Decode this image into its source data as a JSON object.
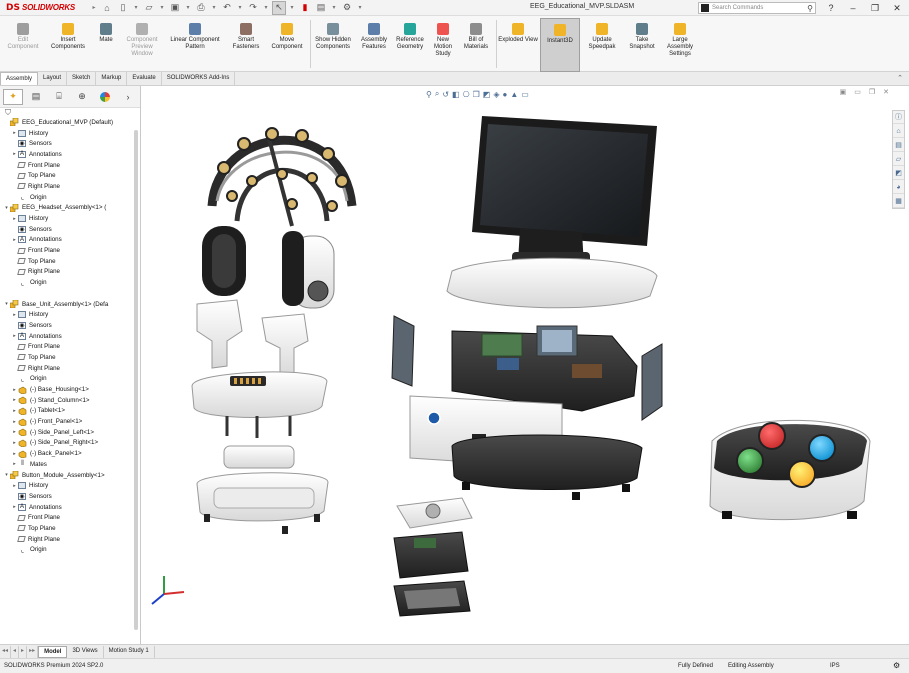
{
  "app": {
    "logo_ds": "DS",
    "logo_name": "SOLIDWORKS",
    "document_title": "EEG_Educational_MVP.SLDASM",
    "search_placeholder": "Search Commands"
  },
  "toolbar": [
    {
      "label": "Edit Component",
      "disabled": true,
      "icon": "edit-component-icon",
      "color": "#9e9e9e"
    },
    {
      "label": "Insert Components",
      "icon": "insert-components-icon",
      "color": "#f0b429"
    },
    {
      "label": "Mate",
      "icon": "mate-icon",
      "color": "#607d8b"
    },
    {
      "label": "Component Preview Window",
      "disabled": true,
      "icon": "preview-window-icon",
      "color": "#b0b0b0"
    },
    {
      "label": "Linear Component Pattern",
      "icon": "pattern-icon",
      "color": "#5c7ea8"
    },
    {
      "label": "Smart Fasteners",
      "icon": "fasteners-icon",
      "color": "#8d6e63"
    },
    {
      "label": "Move Component",
      "icon": "move-component-icon",
      "color": "#f0b429"
    },
    {
      "label": "Show Hidden Components",
      "icon": "show-hidden-icon",
      "color": "#78909c"
    },
    {
      "label": "Assembly Features",
      "icon": "assembly-features-icon",
      "color": "#5c7ea8"
    },
    {
      "label": "Reference Geometry",
      "icon": "reference-geometry-icon",
      "color": "#26a69a"
    },
    {
      "label": "New Motion Study",
      "icon": "motion-study-icon",
      "color": "#ef5350"
    },
    {
      "label": "Bill of Materials",
      "icon": "bom-icon",
      "color": "#8d8d8d"
    },
    {
      "label": "Exploded View",
      "icon": "exploded-view-icon",
      "color": "#f0b429"
    },
    {
      "label": "Instant3D",
      "active": true,
      "icon": "instant3d-icon",
      "color": "#f0b429"
    },
    {
      "label": "Update Speedpak",
      "icon": "speedpak-icon",
      "color": "#f0b429"
    },
    {
      "label": "Take Snapshot",
      "icon": "snapshot-icon",
      "color": "#607d8b"
    },
    {
      "label": "Large Assembly Settings",
      "icon": "large-assembly-icon",
      "color": "#f0b429"
    }
  ],
  "tabs": [
    "Assembly",
    "Layout",
    "Sketch",
    "Markup",
    "Evaluate",
    "SOLIDWORKS Add-Ins"
  ],
  "tree": [
    {
      "level": 0,
      "exp": "",
      "icon": "asm",
      "label": "EEG_Educational_MVP (Default)"
    },
    {
      "level": 1,
      "exp": "▸",
      "icon": "folder",
      "label": "History"
    },
    {
      "level": 1,
      "exp": "",
      "icon": "sensor",
      "label": "Sensors"
    },
    {
      "level": 1,
      "exp": "▸",
      "icon": "annot",
      "label": "Annotations"
    },
    {
      "level": 1,
      "exp": "",
      "icon": "plane",
      "label": "Front Plane"
    },
    {
      "level": 1,
      "exp": "",
      "icon": "plane",
      "label": "Top Plane"
    },
    {
      "level": 1,
      "exp": "",
      "icon": "plane",
      "label": "Right Plane"
    },
    {
      "level": 1,
      "exp": "",
      "icon": "origin",
      "label": "Origin"
    },
    {
      "level": 0,
      "exp": "▾",
      "icon": "asm",
      "label": "EEG_Headset_Assembly<1> ("
    },
    {
      "level": 1,
      "exp": "▸",
      "icon": "folder",
      "label": "History"
    },
    {
      "level": 1,
      "exp": "",
      "icon": "sensor",
      "label": "Sensors"
    },
    {
      "level": 1,
      "exp": "▸",
      "icon": "annot",
      "label": "Annotations"
    },
    {
      "level": 1,
      "exp": "",
      "icon": "plane",
      "label": "Front Plane"
    },
    {
      "level": 1,
      "exp": "",
      "icon": "plane",
      "label": "Top Plane"
    },
    {
      "level": 1,
      "exp": "",
      "icon": "plane",
      "label": "Right Plane"
    },
    {
      "level": 1,
      "exp": "",
      "icon": "origin",
      "label": "Origin"
    },
    {
      "level": -1,
      "exp": "",
      "icon": "",
      "label": ""
    },
    {
      "level": 0,
      "exp": "▾",
      "icon": "asm",
      "label": "Base_Unit_Assembly<1> (Defa"
    },
    {
      "level": 1,
      "exp": "▸",
      "icon": "folder",
      "label": "History"
    },
    {
      "level": 1,
      "exp": "",
      "icon": "sensor",
      "label": "Sensors"
    },
    {
      "level": 1,
      "exp": "▸",
      "icon": "annot",
      "label": "Annotations"
    },
    {
      "level": 1,
      "exp": "",
      "icon": "plane",
      "label": "Front Plane"
    },
    {
      "level": 1,
      "exp": "",
      "icon": "plane",
      "label": "Top Plane"
    },
    {
      "level": 1,
      "exp": "",
      "icon": "plane",
      "label": "Right Plane"
    },
    {
      "level": 1,
      "exp": "",
      "icon": "origin",
      "label": "Origin"
    },
    {
      "level": 1,
      "exp": "▸",
      "icon": "part",
      "label": "(-) Base_Housing<1>"
    },
    {
      "level": 1,
      "exp": "▸",
      "icon": "part",
      "label": "(-) Stand_Column<1>"
    },
    {
      "level": 1,
      "exp": "▸",
      "icon": "part",
      "label": "(-) Tablet<1>"
    },
    {
      "level": 1,
      "exp": "▸",
      "icon": "part",
      "label": "(-) Front_Panel<1>"
    },
    {
      "level": 1,
      "exp": "▸",
      "icon": "part",
      "label": "(-) Side_Panel_Left<1>"
    },
    {
      "level": 1,
      "exp": "▸",
      "icon": "part",
      "label": "(-) Side_Panel_Right<1>"
    },
    {
      "level": 1,
      "exp": "▸",
      "icon": "part",
      "label": "(-) Back_Panel<1>"
    },
    {
      "level": 1,
      "exp": "▸",
      "icon": "mates",
      "label": "Mates"
    },
    {
      "level": 0,
      "exp": "▾",
      "icon": "asm",
      "label": "Button_Module_Assembly<1>"
    },
    {
      "level": 1,
      "exp": "▸",
      "icon": "folder",
      "label": "History"
    },
    {
      "level": 1,
      "exp": "",
      "icon": "sensor",
      "label": "Sensors"
    },
    {
      "level": 1,
      "exp": "▸",
      "icon": "annot",
      "label": "Annotations"
    },
    {
      "level": 1,
      "exp": "",
      "icon": "plane",
      "label": "Front Plane"
    },
    {
      "level": 1,
      "exp": "",
      "icon": "plane",
      "label": "Top Plane"
    },
    {
      "level": 1,
      "exp": "",
      "icon": "plane",
      "label": "Right Plane"
    },
    {
      "level": 1,
      "exp": "",
      "icon": "origin",
      "label": "Origin"
    }
  ],
  "bottom_tabs": [
    "Model",
    "3D Views",
    "Motion Study 1"
  ],
  "status": {
    "product": "SOLIDWORKS Premium 2024 SP2.0",
    "state": "Fully Defined",
    "mode": "Editing Assembly",
    "units": "IPS"
  },
  "colors": {
    "brand_red": "#d40000",
    "button_red": "#e53935",
    "button_blue": "#29b6f6",
    "button_green": "#43a047",
    "button_yellow": "#fdd835"
  }
}
